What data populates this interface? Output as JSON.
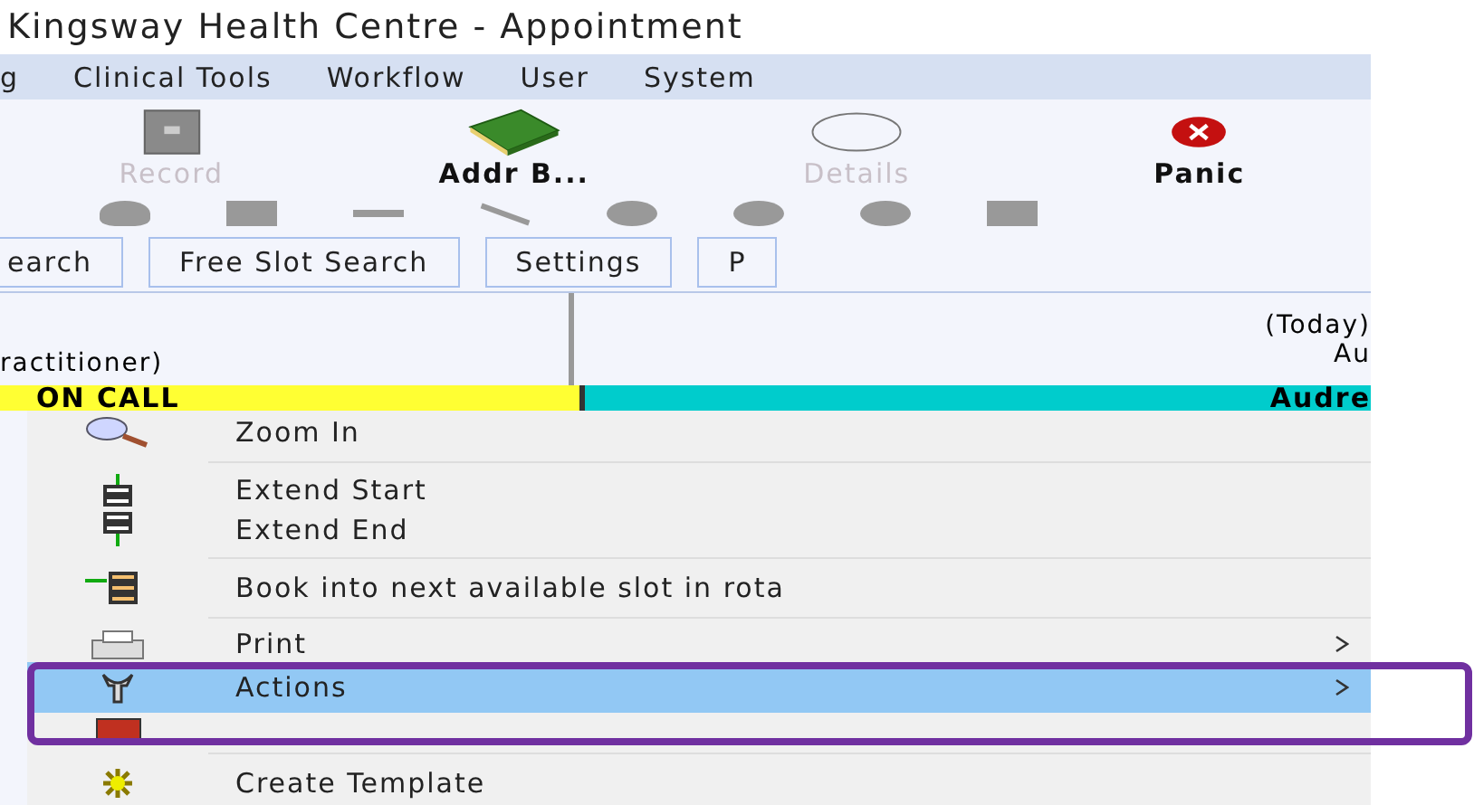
{
  "window": {
    "title": "Kingsway Health Centre - Appointment"
  },
  "menu_bar": [
    "g",
    "Clinical Tools",
    "Workflow",
    "User",
    "System"
  ],
  "toolbar": [
    {
      "label": "Record",
      "disabled": true
    },
    {
      "label": "Addr B...",
      "disabled": false
    },
    {
      "label": "Details",
      "disabled": true
    },
    {
      "label": "Panic",
      "disabled": false
    }
  ],
  "buttons": [
    "earch",
    "Free Slot Search",
    "Settings",
    "P"
  ],
  "header": {
    "left": "ractitioner)",
    "right_top": "(Today)",
    "right_bottom": "Au"
  },
  "session_row": {
    "left": "ON CALL",
    "right": "Audre"
  },
  "context_menu": {
    "groups": [
      [
        {
          "label": "Zoom In",
          "selected": false,
          "submenu": false
        }
      ],
      [
        {
          "label": "Extend Start",
          "selected": false,
          "submenu": false
        },
        {
          "label": "Extend End",
          "selected": false,
          "submenu": false
        }
      ],
      [
        {
          "label": "Book into next available slot in rota",
          "selected": false,
          "submenu": false
        }
      ],
      [
        {
          "label": "Print",
          "selected": false,
          "submenu": true
        },
        {
          "label": "Actions",
          "selected": true,
          "submenu": true
        }
      ],
      [
        {
          "label": "Create Template",
          "selected": false,
          "submenu": false
        }
      ]
    ]
  }
}
